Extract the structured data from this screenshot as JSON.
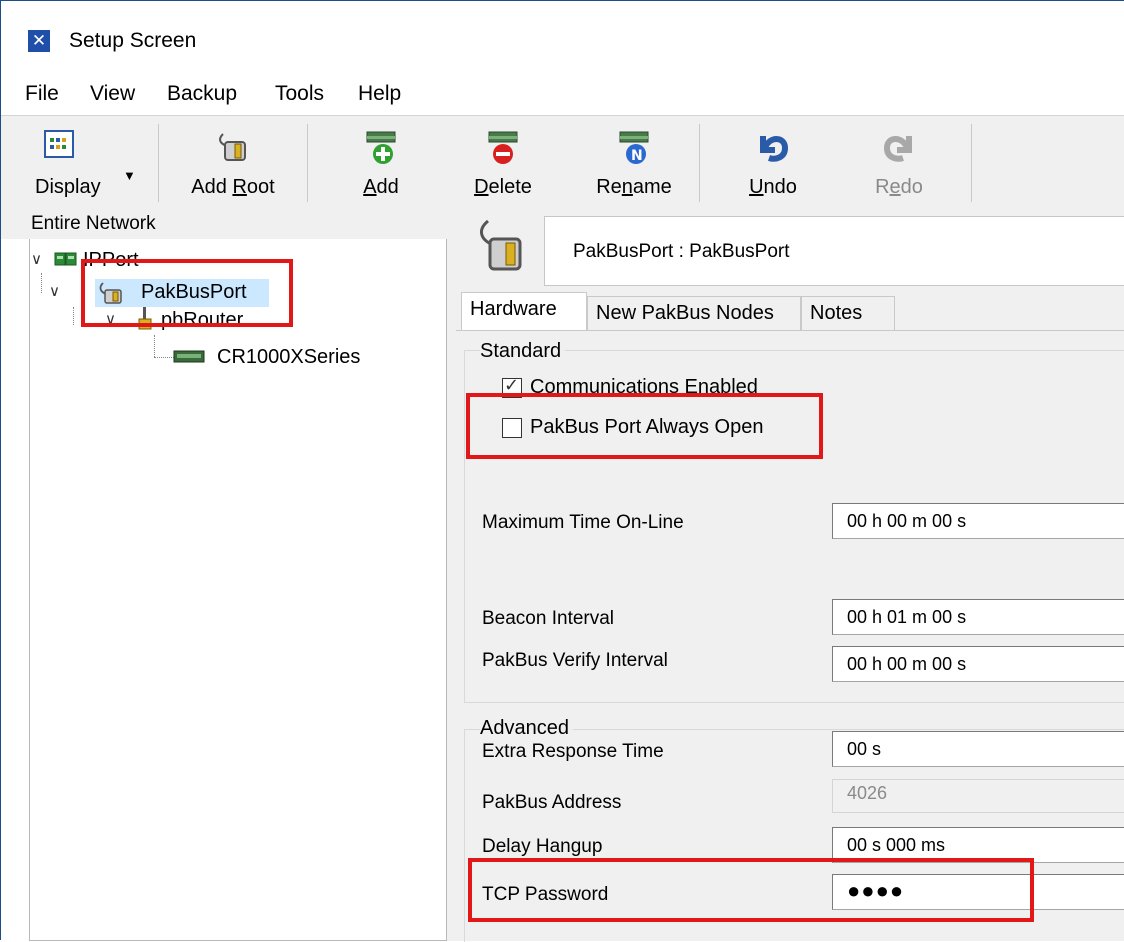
{
  "window": {
    "title": "Setup Screen"
  },
  "menu": [
    "File",
    "View",
    "Backup",
    "Tools",
    "Help"
  ],
  "toolbar": {
    "display": "Display",
    "add_root_pre": "Add ",
    "add_root_u": "R",
    "add_root_post": "oot",
    "add_u": "A",
    "add_post": "dd",
    "delete_u": "D",
    "delete_post": "elete",
    "rename_pre": "Re",
    "rename_u": "n",
    "rename_post": "ame",
    "undo_u": "U",
    "undo_post": "ndo",
    "redo_pre": "R",
    "redo_u": "e",
    "redo_post": "do"
  },
  "tree": {
    "header": "Entire Network",
    "nodes": [
      "IPPort",
      "PakBusPort",
      "pbRouter",
      "CR1000XSeries"
    ]
  },
  "device": {
    "title": "PakBusPort : PakBusPort"
  },
  "tabs": [
    "Hardware",
    "New PakBus Nodes",
    "Notes"
  ],
  "standard": {
    "group_title": "Standard",
    "comm_enabled": "Communications Enabled",
    "always_open": "PakBus Port Always Open",
    "max_time_label": "Maximum Time On-Line",
    "max_time_value": "00 h 00 m 00 s",
    "beacon_label": "Beacon Interval",
    "beacon_value": "00 h 01 m 00 s",
    "verify_label": "PakBus Verify Interval",
    "verify_value": "00 h 00 m 00 s"
  },
  "advanced": {
    "group_title": "Advanced",
    "extra_label": "Extra Response Time",
    "extra_value": "00 s",
    "address_label": "PakBus Address",
    "address_value": "4026",
    "hangup_label": "Delay Hangup",
    "hangup_value": "00 s 000 ms",
    "tcp_label": "TCP Password",
    "tcp_value": "●●●●"
  },
  "colors": {
    "highlight": "#e21818",
    "selection": "#cce8ff",
    "accent": "#1f4fa8"
  }
}
